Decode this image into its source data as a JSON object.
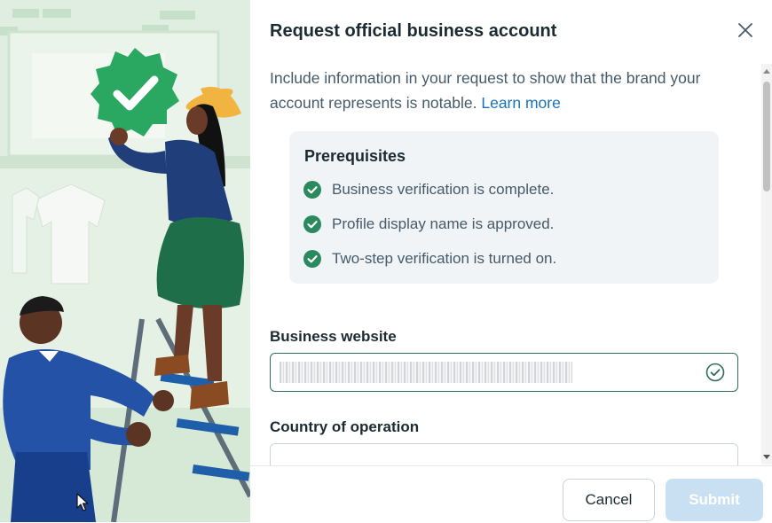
{
  "dialog": {
    "title": "Request official business account",
    "close_icon": "close-icon",
    "intro_text": "Include information in your request to show that the brand your account represents is notable.",
    "learn_more_label": "Learn more"
  },
  "prerequisites": {
    "title": "Prerequisites",
    "items": [
      {
        "label": "Business verification is complete.",
        "icon": "check-circle-icon"
      },
      {
        "label": "Profile display name is approved.",
        "icon": "check-circle-icon"
      },
      {
        "label": "Two-step verification is turned on.",
        "icon": "check-circle-icon"
      }
    ],
    "check_color": "#2a8a5e"
  },
  "form": {
    "website_label": "Business website",
    "website_value": "",
    "website_status_icon": "check-circle-outline-icon",
    "country_label": "Country of operation",
    "country_value": ""
  },
  "footer": {
    "cancel_label": "Cancel",
    "submit_label": "Submit"
  },
  "colors": {
    "accent": "#2f6d5a",
    "link": "#1a73b8",
    "submit_disabled": "#c9e0f3"
  }
}
